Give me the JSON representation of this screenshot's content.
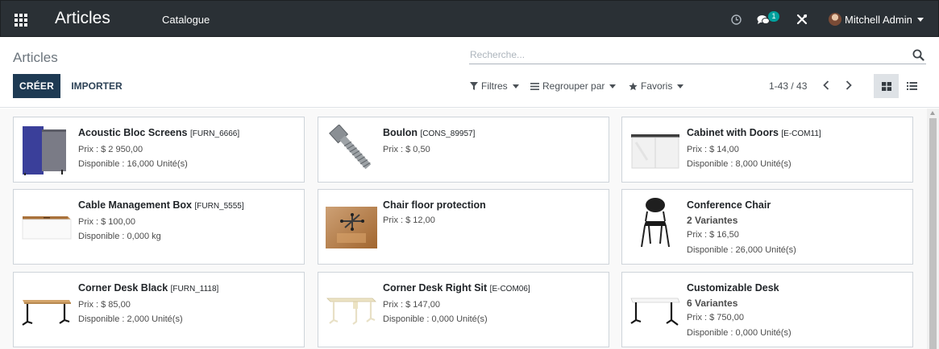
{
  "navbar": {
    "app_title": "Articles",
    "menu": "Catalogue",
    "chat_badge": "1",
    "user_name": "Mitchell Admin"
  },
  "control_panel": {
    "breadcrumb": "Articles",
    "search_placeholder": "Recherche...",
    "create_label": "CRÉER",
    "import_label": "IMPORTER",
    "filters_label": "Filtres",
    "groupby_label": "Regrouper par",
    "favorites_label": "Favoris",
    "pager": "1-43 / 43"
  },
  "colors": {
    "navbar": "#2a3035",
    "primary": "#1e3a53",
    "badge": "#00a09d"
  },
  "products": [
    {
      "name": "Acoustic Bloc Screens",
      "ref": "[FURN_6666]",
      "price": "Prix : $ 2 950,00",
      "available": "Disponible : 16,000 Unité(s)",
      "image": "acoustic-screens-image"
    },
    {
      "name": "Boulon",
      "ref": "[CONS_89957]",
      "price": "Prix : $ 0,50",
      "available": "",
      "image": "bolt-image"
    },
    {
      "name": "Cabinet with Doors",
      "ref": "[E-COM11]",
      "price": "Prix : $ 14,00",
      "available": "Disponible : 8,000 Unité(s)",
      "image": "cabinet-image"
    },
    {
      "name": "Cable Management Box",
      "ref": "[FURN_5555]",
      "price": "Prix : $ 100,00",
      "available": "Disponible : 0,000 kg",
      "image": "cable-box-image"
    },
    {
      "name": "Chair floor protection",
      "ref": "",
      "price": "Prix : $ 12,00",
      "available": "",
      "image": "floor-protection-image"
    },
    {
      "name": "Conference Chair",
      "ref": "",
      "variants": "2 Variantes",
      "price": "Prix : $ 16,50",
      "available": "Disponible : 26,000 Unité(s)",
      "image": "conference-chair-image"
    },
    {
      "name": "Corner Desk Black",
      "ref": "[FURN_1118]",
      "price": "Prix : $ 85,00",
      "available": "Disponible : 2,000 Unité(s)",
      "image": "desk-black-image"
    },
    {
      "name": "Corner Desk Right Sit",
      "ref": "[E-COM06]",
      "price": "Prix : $ 147,00",
      "available": "Disponible : 0,000 Unité(s)",
      "image": "desk-right-image"
    },
    {
      "name": "Customizable Desk",
      "ref": "",
      "variants": "6 Variantes",
      "price": "Prix : $ 750,00",
      "available": "Disponible : 0,000 Unité(s)",
      "image": "custom-desk-image"
    }
  ]
}
